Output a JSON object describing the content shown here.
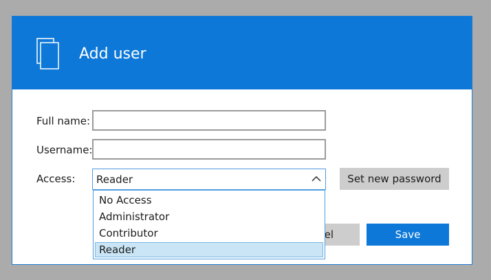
{
  "dialog": {
    "title": "Add user",
    "header_icon": "copy-icon",
    "accent_color": "#0d78d8"
  },
  "form": {
    "full_name_label": "Full name:",
    "full_name_value": "",
    "username_label": "Username:",
    "username_value": "",
    "access_label": "Access:",
    "access_value": "Reader",
    "access_options": [
      "No Access",
      "Administrator",
      "Contributor",
      "Reader"
    ],
    "access_selected_index": 3
  },
  "buttons": {
    "set_password": "Set new password",
    "cancel_visible_fragment": "el",
    "save": "Save"
  }
}
